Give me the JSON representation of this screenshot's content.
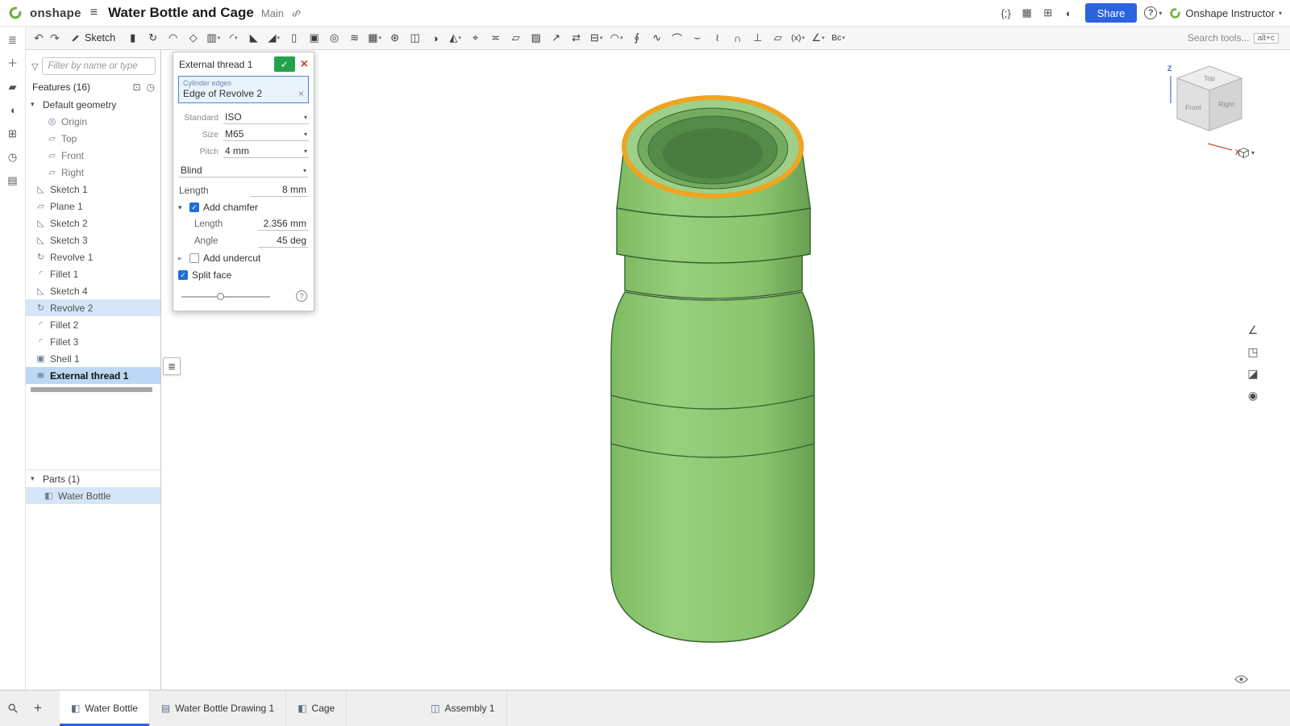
{
  "topbar": {
    "logo_text": "onshape",
    "title": "Water Bottle and Cage",
    "workspace": "Main",
    "share_label": "Share",
    "user_name": "Onshape Instructor",
    "right_icons": [
      {
        "name": "featurescript"
      },
      {
        "name": "spreadsheet"
      },
      {
        "name": "app-grid"
      },
      {
        "name": "theme"
      }
    ]
  },
  "toolbar": {
    "sketch_label": "Sketch",
    "search_placeholder": "Search tools...",
    "shortcut_keys": "alt+c",
    "tools": [
      {
        "name": "extrude",
        "caret": false
      },
      {
        "name": "revolve",
        "caret": false
      },
      {
        "name": "sweep",
        "caret": false
      },
      {
        "name": "loft",
        "caret": false
      },
      {
        "name": "thicken",
        "caret": true
      },
      {
        "name": "fillet",
        "caret": true
      },
      {
        "name": "chamfer",
        "caret": false
      },
      {
        "name": "draft",
        "caret": true
      },
      {
        "name": "rib",
        "caret": false
      },
      {
        "name": "shell",
        "caret": false
      },
      {
        "name": "hole",
        "caret": false
      },
      {
        "name": "thread",
        "caret": false
      },
      {
        "name": "linear-pattern",
        "caret": true
      },
      {
        "name": "circular-pattern",
        "caret": false
      },
      {
        "name": "mirror",
        "caret": false
      },
      {
        "name": "boolean",
        "caret": false
      },
      {
        "name": "split",
        "caret": true
      },
      {
        "name": "transform",
        "caret": false
      },
      {
        "name": "offset-surface",
        "caret": false
      },
      {
        "name": "boundary-surface",
        "caret": false
      },
      {
        "name": "fill",
        "caret": false
      },
      {
        "name": "move-face",
        "caret": false
      },
      {
        "name": "replace-face",
        "caret": false
      },
      {
        "name": "delete-face",
        "caret": true
      },
      {
        "name": "modify-fillet",
        "caret": true
      },
      {
        "name": "helix",
        "caret": false
      },
      {
        "name": "fit-spline",
        "caret": false
      },
      {
        "name": "projected-curve",
        "caret": false
      },
      {
        "name": "bridging-curve",
        "caret": false
      },
      {
        "name": "composite-curve",
        "caret": false
      },
      {
        "name": "intersection-curve",
        "caret": false
      },
      {
        "name": "trim-curve",
        "caret": false
      },
      {
        "name": "plane",
        "caret": false
      },
      {
        "name": "variable",
        "label": "(x)",
        "caret": true
      },
      {
        "name": "measure",
        "caret": true
      },
      {
        "name": "custom-feature",
        "label": "Bc",
        "caret": true
      }
    ]
  },
  "left_rail": {
    "icons": [
      {
        "name": "outline"
      },
      {
        "name": "insert"
      },
      {
        "name": "annotate"
      },
      {
        "name": "comment"
      },
      {
        "name": "share-view"
      },
      {
        "name": "history"
      },
      {
        "name": "notes"
      }
    ]
  },
  "feature_panel": {
    "filter_placeholder": "Filter by name or type",
    "features_header": "Features (16)",
    "tree": [
      {
        "label": "Default geometry",
        "kind": "group"
      },
      {
        "label": "Origin",
        "kind": "child",
        "icon": "origin"
      },
      {
        "label": "Top",
        "kind": "child",
        "icon": "plane"
      },
      {
        "label": "Front",
        "kind": "child",
        "icon": "plane"
      },
      {
        "label": "Right",
        "kind": "child",
        "icon": "plane"
      },
      {
        "label": "Sketch 1",
        "kind": "feature",
        "icon": "sketch"
      },
      {
        "label": "Plane 1",
        "kind": "feature",
        "icon": "plane"
      },
      {
        "label": "Sketch 2",
        "kind": "feature",
        "icon": "sketch"
      },
      {
        "label": "Sketch 3",
        "kind": "feature",
        "icon": "sketch"
      },
      {
        "label": "Revolve 1",
        "kind": "feature",
        "icon": "revolve"
      },
      {
        "label": "Fillet 1",
        "kind": "feature",
        "icon": "fillet"
      },
      {
        "label": "Sketch 4",
        "kind": "feature",
        "icon": "sketch"
      },
      {
        "label": "Revolve 2",
        "kind": "feature",
        "icon": "revolve",
        "state": "highlight"
      },
      {
        "label": "Fillet 2",
        "kind": "feature",
        "icon": "fillet"
      },
      {
        "label": "Fillet 3",
        "kind": "feature",
        "icon": "fillet"
      },
      {
        "label": "Shell 1",
        "kind": "feature",
        "icon": "shell"
      },
      {
        "label": "External thread 1",
        "kind": "feature",
        "icon": "thread",
        "state": "selected"
      }
    ],
    "parts_header": "Parts (1)",
    "parts": [
      {
        "label": "Water Bottle",
        "icon": "part",
        "state": "highlight"
      }
    ]
  },
  "dialog": {
    "title": "External thread 1",
    "selection": {
      "label": "Cylinder edges",
      "value": "Edge of Revolve 2"
    },
    "params": [
      {
        "label": "Standard",
        "value": "ISO"
      },
      {
        "label": "Size",
        "value": "M65"
      },
      {
        "label": "Pitch",
        "value": "4 mm"
      }
    ],
    "end_type": "Blind",
    "length": {
      "label": "Length",
      "value": "8 mm"
    },
    "chamfer": {
      "label": "Add chamfer",
      "checked": true,
      "rows": [
        {
          "label": "Length",
          "value": "2.356 mm"
        },
        {
          "label": "Angle",
          "value": "45 deg"
        }
      ]
    },
    "undercut": {
      "label": "Add undercut",
      "checked": false
    },
    "split_face": {
      "label": "Split face",
      "checked": true
    }
  },
  "viewport": {
    "viewcube": {
      "top": "Top",
      "front": "Front",
      "right": "Right",
      "z_axis": "Z",
      "x_axis": "X"
    },
    "side_tools": [
      {
        "name": "analysis"
      },
      {
        "name": "view-settings"
      },
      {
        "name": "section-view"
      },
      {
        "name": "named-views"
      }
    ],
    "colors": {
      "bottle_fill": "#8cc671",
      "bottle_outline": "#35642c",
      "thread_highlight": "#f0a41f",
      "accent_blue": "#2b62e0"
    }
  },
  "tabs": {
    "items": [
      {
        "label": "Water Bottle",
        "icon": "part-studio",
        "active": true
      },
      {
        "label": "Water Bottle Drawing 1",
        "icon": "drawing",
        "active": false
      },
      {
        "label": "Cage",
        "icon": "part-studio",
        "active": false
      },
      {
        "label": "Assembly 1",
        "icon": "assembly",
        "active": false,
        "gap": true
      }
    ]
  }
}
